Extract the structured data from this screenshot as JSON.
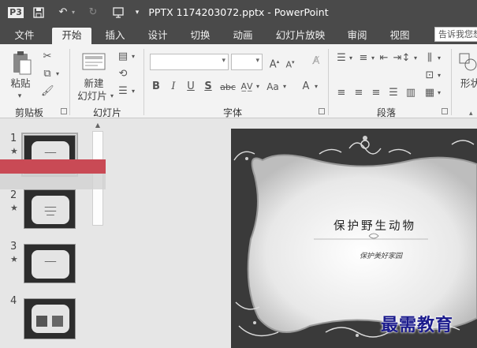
{
  "titlebar": {
    "app_icon": "P3",
    "title": "PPTX 1174203072.pptx - PowerPoint",
    "save_icon": "save-icon",
    "undo_icon": "undo-icon",
    "redo_icon": "redo-icon",
    "present_icon": "present-from-start-icon",
    "customize_icon": "customize-qat-icon"
  },
  "tabs": [
    "文件",
    "开始",
    "插入",
    "设计",
    "切换",
    "动画",
    "幻灯片放映",
    "审阅",
    "视图"
  ],
  "active_tab": "开始",
  "tellme_placeholder": "告诉我您想",
  "ribbon": {
    "clipboard": {
      "label": "剪贴板",
      "paste_label": "粘贴"
    },
    "slides": {
      "label": "幻灯片",
      "new_slide_label_1": "新建",
      "new_slide_label_2": "幻灯片"
    },
    "font": {
      "label": "字体",
      "font_name": "",
      "font_size": ""
    },
    "paragraph": {
      "label": "段落"
    },
    "drawing": {
      "shape_label": "形状"
    }
  },
  "slides_pane": {
    "slides": [
      {
        "number": "1",
        "starred": true,
        "selected": true
      },
      {
        "number": "2",
        "starred": true,
        "selected": false
      },
      {
        "number": "3",
        "starred": true,
        "selected": false
      },
      {
        "number": "4",
        "starred": false,
        "selected": false
      }
    ]
  },
  "slide": {
    "title": "保护野生动物",
    "subtitle": "保护美好家园"
  },
  "watermark": "最需教育",
  "colors": {
    "titlebar_bg": "#4a4a4a",
    "ribbon_bg": "#f3f3f3",
    "slide_bg": "#3c3c3c",
    "redaction": "#c94a55",
    "watermark": "#1a1a8c"
  }
}
